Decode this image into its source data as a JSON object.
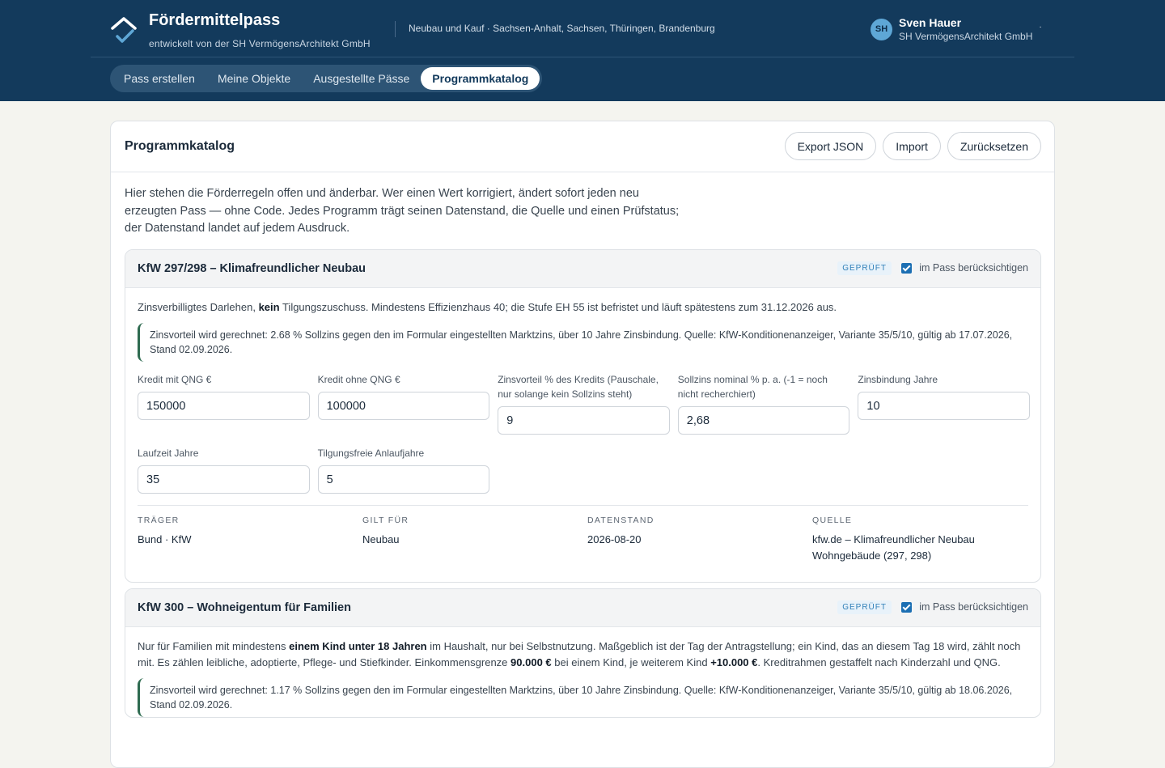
{
  "header": {
    "brand_title": "Fördermittelpass",
    "brand_subtitle": "entwickelt von der SH VermögensArchitekt GmbH",
    "region": "Neubau und Kauf · Sachsen-Anhalt, Sachsen, Thüringen, Brandenburg",
    "user": {
      "initials": "SH",
      "name": "Sven Hauer",
      "org": "SH VermögensArchitekt GmbH",
      "menu_dot": "·"
    }
  },
  "nav": {
    "tabs": [
      {
        "label": "Pass erstellen",
        "active": false
      },
      {
        "label": "Meine Objekte",
        "active": false
      },
      {
        "label": "Ausgestellte Pässe",
        "active": false
      },
      {
        "label": "Programmkatalog",
        "active": true
      }
    ]
  },
  "page": {
    "title": "Programmkatalog",
    "actions": {
      "export": "Export JSON",
      "import": "Import",
      "reset": "Zurücksetzen"
    },
    "intro": "Hier stehen die Förderregeln offen und änderbar. Wer einen Wert korrigiert, ändert sofort jeden neu erzeugten Pass — ohne Code. Jedes Programm trägt seinen Datenstand, die Quelle und einen Prüfstatus; der Datenstand landet auf jedem Ausdruck."
  },
  "programs": [
    {
      "title": "KfW 297/298 – Klimafreundlicher Neubau",
      "badge": "GEPRÜFT",
      "include_label": "im Pass berücksichtigen",
      "include_checked": true,
      "desc": {
        "p1": "Zinsverbilligtes Darlehen, ",
        "b1": "kein",
        "p2": " Tilgungszuschuss. Mindestens Effizienzhaus 40; die Stufe EH 55 ist befristet und läuft spätestens zum 31.12.2026 aus."
      },
      "note": "Zinsvorteil wird gerechnet: 2.68 % Sollzins gegen den im Formular eingestellten Marktzins, über 10 Jahre Zinsbindung. Quelle: KfW-Konditionenanzeiger, Variante 35/5/10, gültig ab 17.07.2026, Stand 02.09.2026.",
      "fields": [
        {
          "label": "Kredit mit QNG €",
          "value": "150000"
        },
        {
          "label": "Kredit ohne QNG €",
          "value": "100000"
        },
        {
          "label": "Zinsvorteil % des Kredits (Pauschale, nur solange kein Sollzins steht)",
          "value": "9"
        },
        {
          "label": "Sollzins nominal % p. a. (-1 = noch nicht recherchiert)",
          "value": "2,68"
        },
        {
          "label": "Zinsbindung Jahre",
          "value": "10"
        },
        {
          "label": "Laufzeit Jahre",
          "value": "35"
        },
        {
          "label": "Tilgungsfreie Anlaufjahre",
          "value": "5"
        }
      ],
      "meta": [
        {
          "key": "TRÄGER",
          "value": "Bund · KfW"
        },
        {
          "key": "GILT FÜR",
          "value": "Neubau"
        },
        {
          "key": "DATENSTAND",
          "value": "2026-08-20"
        },
        {
          "key": "QUELLE",
          "value": "kfw.de – Klimafreundlicher Neubau Wohngebäude (297, 298)"
        }
      ]
    },
    {
      "title": "KfW 300 – Wohneigentum für Familien",
      "badge": "GEPRÜFT",
      "include_label": "im Pass berücksichtigen",
      "include_checked": true,
      "desc": {
        "p1": "Nur für Familien mit mindestens ",
        "b1": "einem Kind unter 18 Jahren",
        "p2": " im Haushalt, nur bei Selbstnutzung. Maßgeblich ist der Tag der Antragstellung; ein Kind, das an diesem Tag 18 wird, zählt noch mit. Es zählen leibliche, adoptierte, Pflege- und Stiefkinder. Einkommensgrenze ",
        "b2": "90.000 €",
        "p3": " bei einem Kind, je weiterem Kind ",
        "b3": "+10.000 €",
        "p4": ". Kreditrahmen gestaffelt nach Kinderzahl und QNG."
      },
      "note": "Zinsvorteil wird gerechnet: 1.17 % Sollzins gegen den im Formular eingestellten Marktzins, über 10 Jahre Zinsbindung. Quelle: KfW-Konditionenanzeiger, Variante 35/5/10, gültig ab 18.06.2026, Stand 02.09.2026."
    }
  ],
  "colors": {
    "header_bg": "#133a5c",
    "accent": "#1c6fb3",
    "note_border": "#2e6b50",
    "badge": "#2f7fb8"
  }
}
